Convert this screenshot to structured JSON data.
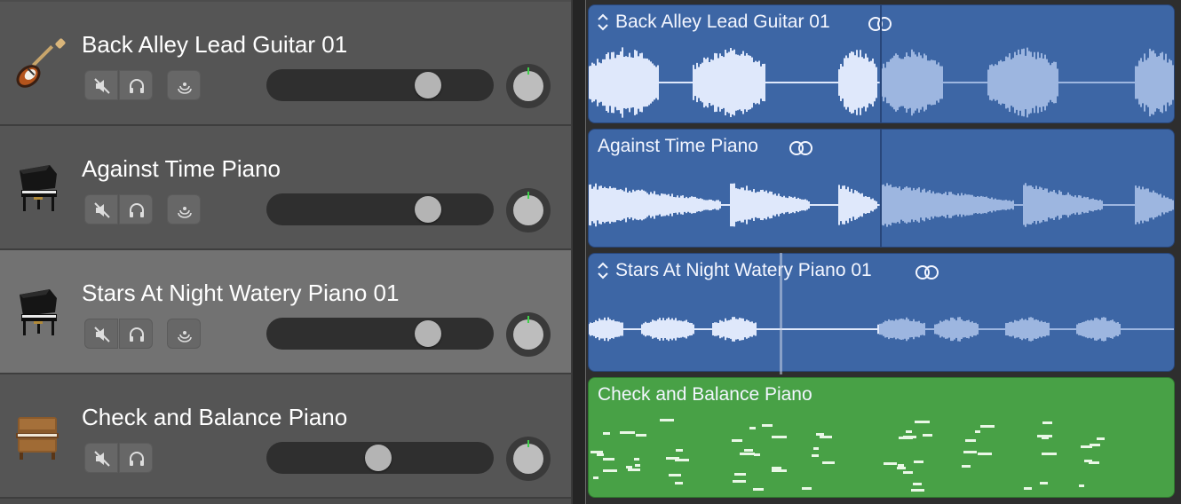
{
  "tracks": [
    {
      "name": "Back Alley Lead Guitar 01",
      "icon": "electric-guitar-icon",
      "volume": 0.72,
      "has_monitor": true,
      "selected": false
    },
    {
      "name": "Against Time Piano",
      "icon": "grand-piano-icon",
      "volume": 0.72,
      "has_monitor": true,
      "selected": false
    },
    {
      "name": "Stars At Night Watery Piano 01",
      "icon": "grand-piano-icon",
      "volume": 0.72,
      "has_monitor": true,
      "selected": true
    },
    {
      "name": "Check and Balance Piano",
      "icon": "upright-piano-icon",
      "volume": 0.49,
      "has_monitor": false,
      "selected": false
    }
  ],
  "regions": [
    {
      "title": "Back Alley Lead Guitar 01",
      "type": "audio",
      "color": "#3d66a5",
      "loop": true,
      "chevron": true
    },
    {
      "title": "Against Time Piano",
      "type": "audio",
      "color": "#3d66a5",
      "loop": true,
      "chevron": false
    },
    {
      "title": "Stars At Night Watery Piano 01",
      "type": "audio",
      "color": "#3d66a5",
      "loop": true,
      "chevron": true
    },
    {
      "title": "Check and Balance Piano",
      "type": "midi",
      "color": "#48a146",
      "loop": false,
      "chevron": false
    }
  ]
}
